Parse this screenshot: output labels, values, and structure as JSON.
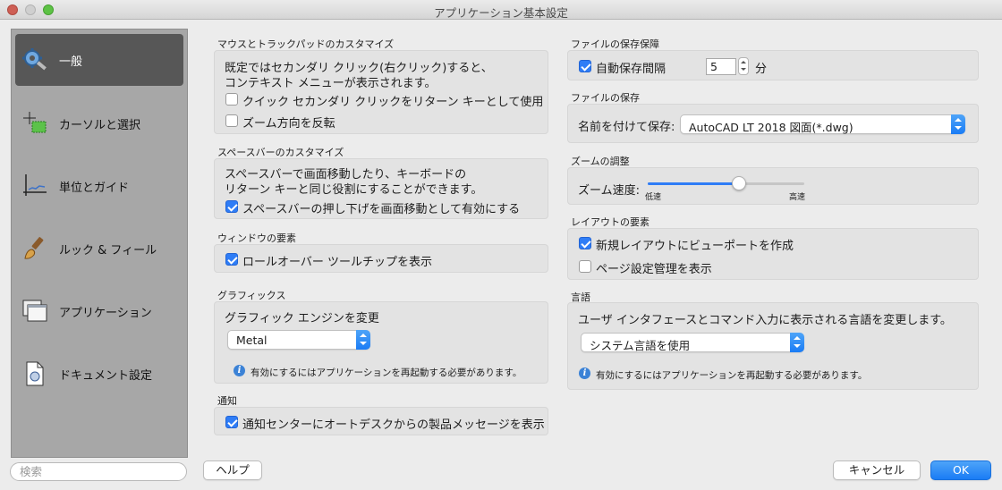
{
  "window": {
    "title": "アプリケーション基本設定"
  },
  "sidebar": {
    "items": [
      {
        "label": "一般",
        "icon": "gear-wrench-icon",
        "selected": true
      },
      {
        "label": "カーソルと選択",
        "icon": "cursor-select-icon",
        "selected": false
      },
      {
        "label": "単位とガイド",
        "icon": "units-guide-icon",
        "selected": false
      },
      {
        "label": "ルック & フィール",
        "icon": "paintbrush-icon",
        "selected": false
      },
      {
        "label": "アプリケーション",
        "icon": "windows-icon",
        "selected": false
      },
      {
        "label": "ドキュメント設定",
        "icon": "document-icon",
        "selected": false
      }
    ],
    "search_placeholder": "検索"
  },
  "left": {
    "mouse": {
      "title": "マウスとトラックパッドのカスタマイズ",
      "desc1": "既定ではセカンダリ クリック(右クリック)すると、",
      "desc2": "コンテキスト メニューが表示されます。",
      "cb1": {
        "label": "クイック セカンダリ クリックをリターン キーとして使用",
        "checked": false
      },
      "cb2": {
        "label": "ズーム方向を反転",
        "checked": false
      }
    },
    "spacebar": {
      "title": "スペースバーのカスタマイズ",
      "desc1": "スペースバーで画面移動したり、キーボードの",
      "desc2": "リターン キーと同じ役割にすることができます。",
      "cb1": {
        "label": "スペースバーの押し下げを画面移動として有効にする",
        "checked": true
      }
    },
    "window_elements": {
      "title": "ウィンドウの要素",
      "cb1": {
        "label": "ロールオーバー ツールチップを表示",
        "checked": true
      }
    },
    "graphics": {
      "title": "グラフィックス",
      "desc": "グラフィック エンジンを変更",
      "select_value": "Metal",
      "note": "有効にするにはアプリケーションを再起動する必要があります。"
    },
    "notify": {
      "title": "通知",
      "cb1": {
        "label": "通知センターにオートデスクからの製品メッセージを表示",
        "checked": true
      }
    }
  },
  "right": {
    "autosave": {
      "title": "ファイルの保存保障",
      "cb_label": "自動保存間隔",
      "checked": true,
      "value": "5",
      "unit": "分"
    },
    "filesave": {
      "title": "ファイルの保存",
      "label": "名前を付けて保存:",
      "select_value": "AutoCAD LT 2018 図面(*.dwg)"
    },
    "zoom": {
      "title": "ズームの調整",
      "label": "ズーム速度:",
      "low": "低速",
      "high": "高速",
      "level": 0.58
    },
    "layout": {
      "title": "レイアウトの要素",
      "cb1": {
        "label": "新規レイアウトにビューポートを作成",
        "checked": true
      },
      "cb2": {
        "label": "ページ設定管理を表示",
        "checked": false
      }
    },
    "language": {
      "title": "言語",
      "desc": "ユーザ インタフェースとコマンド入力に表示される言語を変更します。",
      "select_value": "システム言語を使用",
      "note": "有効にするにはアプリケーションを再起動する必要があります。"
    }
  },
  "buttons": {
    "help": "ヘルプ",
    "cancel": "キャンセル",
    "ok": "OK"
  },
  "colors": {
    "accent": "#2f7df6",
    "sidebar_bg": "#a7a7a7",
    "selected_bg": "#575757"
  }
}
